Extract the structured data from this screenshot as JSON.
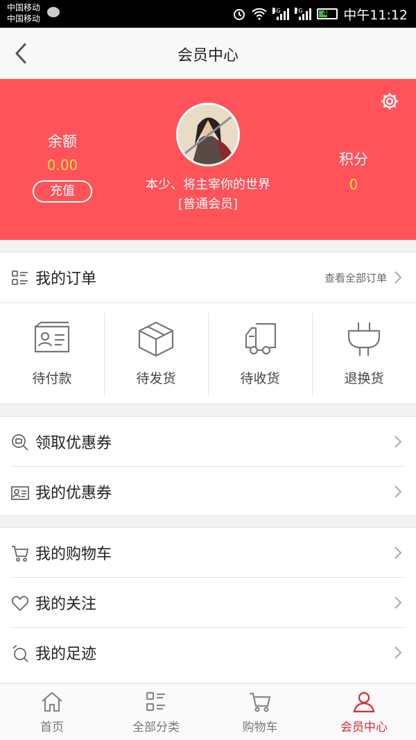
{
  "status_bar": {
    "carrier_1": "中国移动",
    "carrier_2": "中国移动",
    "net_1": "4G",
    "net_2": "2G",
    "battery_level": 47,
    "battery_text": "47",
    "time": "中午11:12"
  },
  "header": {
    "title": "会员中心",
    "back_icon": "chevron-left-icon"
  },
  "profile": {
    "balance_label": "余额",
    "balance_value": "0.00",
    "recharge_label": "充值",
    "nickname": "本少、将主宰你的世界",
    "level": "[普通会员]",
    "points_label": "积分",
    "points_value": "0",
    "settings_icon": "gear-icon",
    "bg_color": "#ff5259",
    "value_color": "#ffe24b"
  },
  "orders": {
    "title": "我的订单",
    "view_all": "查看全部订单",
    "statuses": [
      {
        "label": "待付款",
        "icon": "card-icon"
      },
      {
        "label": "待发货",
        "icon": "box-icon"
      },
      {
        "label": "待收货",
        "icon": "truck-icon"
      },
      {
        "label": "退换货",
        "icon": "plug-icon"
      }
    ]
  },
  "coupons": [
    {
      "label": "领取优惠券",
      "icon": "coupon-search-icon"
    },
    {
      "label": "我的优惠券",
      "icon": "coupon-card-icon"
    }
  ],
  "personal": [
    {
      "label": "我的购物车",
      "icon": "cart-icon"
    },
    {
      "label": "我的关注",
      "icon": "heart-icon"
    },
    {
      "label": "我的足迹",
      "icon": "footprint-icon"
    }
  ],
  "tabbar": {
    "items": [
      {
        "label": "首页",
        "icon": "home-icon"
      },
      {
        "label": "全部分类",
        "icon": "category-icon"
      },
      {
        "label": "购物车",
        "icon": "cart-icon"
      },
      {
        "label": "会员中心",
        "icon": "user-icon",
        "active": true
      }
    ],
    "active_color": "#e0262e"
  }
}
